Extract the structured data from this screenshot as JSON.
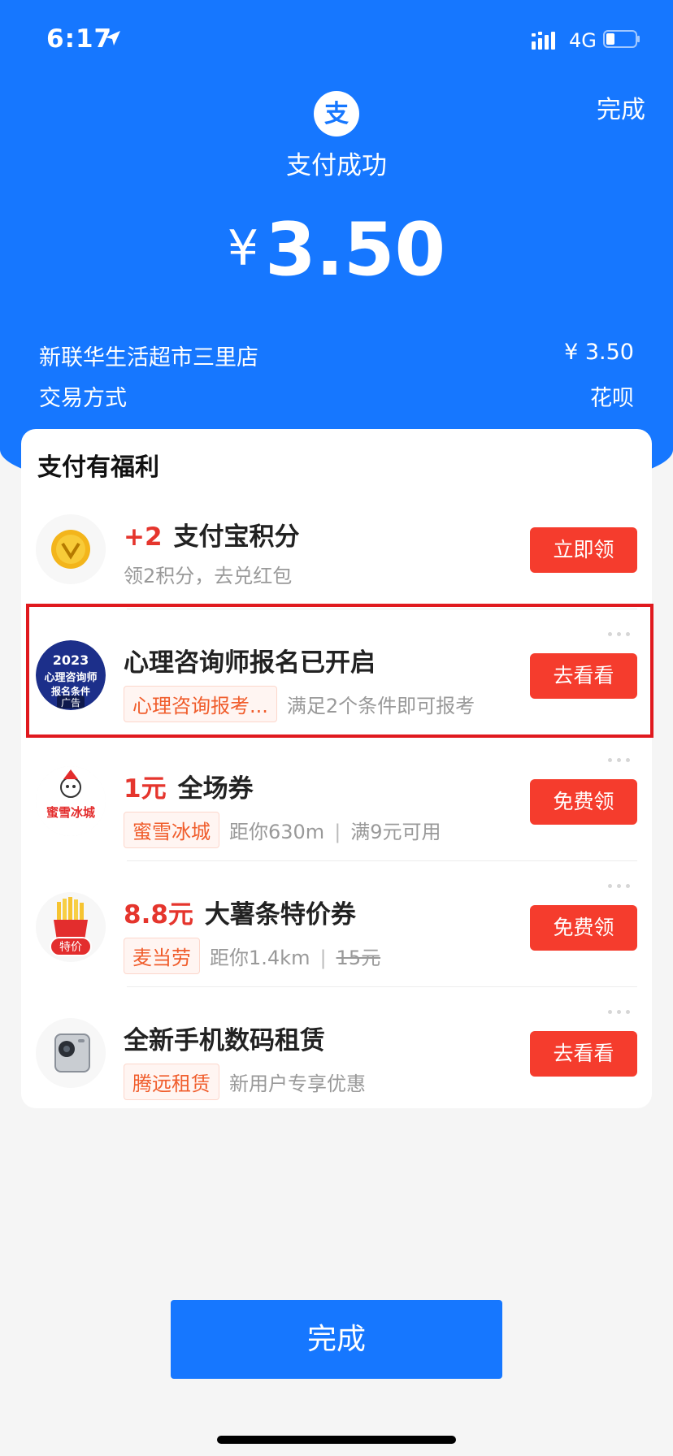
{
  "status_bar": {
    "time": "6:17",
    "network": "4G"
  },
  "header": {
    "done_label": "完成",
    "status_text": "支付成功",
    "currency_symbol": "¥",
    "amount": "3.50"
  },
  "transaction": {
    "merchant_name": "新联华生活超市三里店",
    "merchant_amount": "¥ 3.50",
    "method_label": "交易方式",
    "method_value": "花呗"
  },
  "benefits": {
    "title": "支付有福利",
    "items": [
      {
        "highlight": "+2",
        "title": "支付宝积分",
        "subtitle": "领2积分，去兑红包",
        "button": "立即领",
        "icon": "gold-coin-icon"
      },
      {
        "title": "心理咨询师报名已开启",
        "tag": "心理咨询报考...",
        "subtitle": "满足2个条件即可报考",
        "button": "去看看",
        "icon": "ad-thumbnail",
        "thumb_year": "2023",
        "thumb_line": "心理咨询师",
        "thumb_line2": "报名条件",
        "thumb_badge": "广告"
      },
      {
        "highlight": "1元",
        "title": "全场券",
        "tag": "蜜雪冰城",
        "distance": "距你630m",
        "condition": "满9元可用",
        "button": "免费领",
        "icon": "mixue-logo",
        "logo_text": "蜜雪冰城"
      },
      {
        "highlight": "8.8元",
        "title": "大薯条特价券",
        "tag": "麦当劳",
        "distance": "距你1.4km",
        "original_price": "15元",
        "button": "免费领",
        "icon": "fries-icon",
        "badge": "特价"
      },
      {
        "title": "全新手机数码租赁",
        "tag": "腾远租赁",
        "subtitle": "新用户专享优惠",
        "button": "去看看",
        "icon": "phone-icon"
      }
    ]
  },
  "footer": {
    "done_label": "完成"
  },
  "colors": {
    "brand_blue": "#1677ff",
    "cta_red": "#f53c2d",
    "highlight_red": "#e5352d",
    "tag_orange": "#f05d2c"
  }
}
